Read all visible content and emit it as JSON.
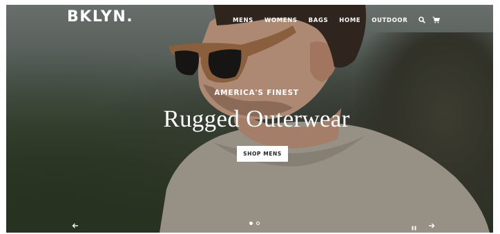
{
  "header": {
    "logo": "BKLYN.",
    "nav": [
      {
        "label": "MENS"
      },
      {
        "label": "WOMENS"
      },
      {
        "label": "BAGS"
      },
      {
        "label": "HOME"
      },
      {
        "label": "OUTDOOR"
      }
    ],
    "icons": [
      "search-icon",
      "cart-icon"
    ]
  },
  "hero": {
    "eyebrow": "AMERICA'S FINEST",
    "headline": "Rugged Outerwear",
    "cta_label": "SHOP MENS"
  },
  "slider": {
    "total_slides": 2,
    "active_slide": 1,
    "controls": [
      "arrow-left-icon",
      "pause-icon",
      "arrow-right-icon"
    ]
  },
  "colors": {
    "text": "#ffffff",
    "button_bg": "#ffffff",
    "button_text": "#222222"
  }
}
